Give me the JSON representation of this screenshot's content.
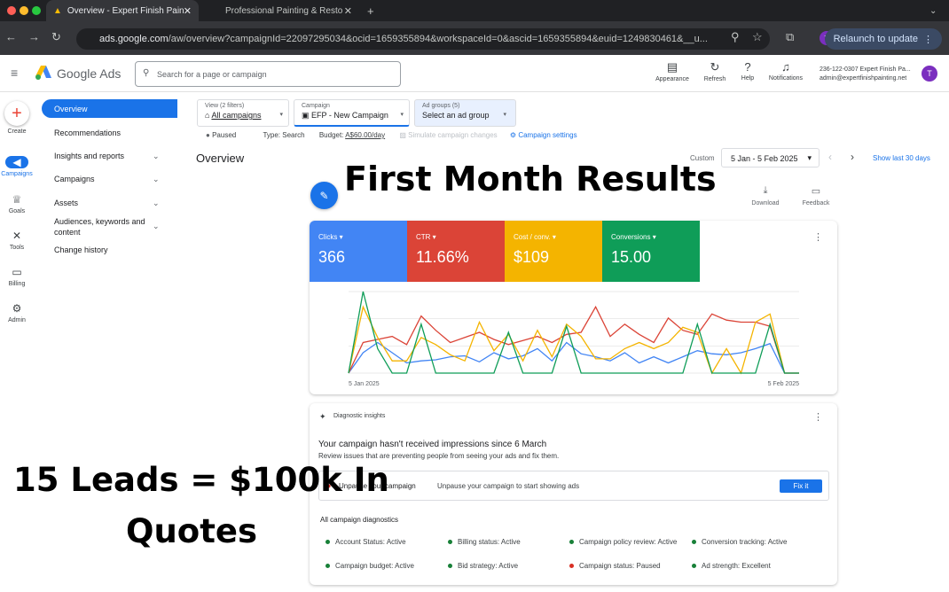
{
  "browser": {
    "tabs": [
      {
        "label": "Overview - Expert Finish Pain"
      },
      {
        "label": "Professional Painting & Resto"
      }
    ],
    "url_host": "ads.google.com",
    "url_path": "/aw/overview?campaignId=22097295034&ocid=1659355894&workspaceId=0&ascid=1659355894&euid=1249830461&__u...",
    "profile_initial": "T",
    "relaunch_label": "Relaunch to update"
  },
  "topbar": {
    "product_name": "Google Ads",
    "search_placeholder": "Search for a page or campaign",
    "icons": [
      {
        "label": "Appearance"
      },
      {
        "label": "Refresh"
      },
      {
        "label": "Help"
      },
      {
        "label": "Notifications"
      }
    ],
    "account_line1": "236-122-0307 Expert Finish Pa...",
    "account_line2": "admin@expertfinishpainting.net",
    "avatar_initial": "T"
  },
  "rail": {
    "create": "Create",
    "items": [
      {
        "label": "Campaigns"
      },
      {
        "label": "Goals"
      },
      {
        "label": "Tools"
      },
      {
        "label": "Billing"
      },
      {
        "label": "Admin"
      }
    ]
  },
  "menu": {
    "items": [
      {
        "label": "Overview"
      },
      {
        "label": "Recommendations"
      },
      {
        "label": "Insights and reports"
      },
      {
        "label": "Campaigns"
      },
      {
        "label": "Assets"
      },
      {
        "label": "Audiences, keywords and content"
      },
      {
        "label": "Change history"
      }
    ]
  },
  "filters": {
    "view_label": "View (2 filters)",
    "view_value": "All campaigns",
    "campaign_label": "Campaign",
    "campaign_value": "EFP - New Campaign",
    "adgroups_label": "Ad groups (5)",
    "adgroups_value": "Select an ad group"
  },
  "status": {
    "paused": "Paused",
    "type": "Type: Search",
    "budget_label": "Budget:",
    "budget_value": "A$60.00/day",
    "simulate": "Simulate campaign changes",
    "settings": "Campaign settings"
  },
  "header": {
    "page_title": "Overview",
    "date_custom": "Custom",
    "date_range": "5 Jan - 5 Feb 2025",
    "show_last": "Show last 30 days",
    "download": "Download",
    "feedback": "Feedback"
  },
  "metrics": [
    {
      "label": "Clicks",
      "value": "366",
      "color": "#4285f4"
    },
    {
      "label": "CTR",
      "value": "11.66%",
      "color": "#db4437"
    },
    {
      "label": "Cost / conv.",
      "value": "$109",
      "color": "#f4b400"
    },
    {
      "label": "Conversions",
      "value": "15.00",
      "color": "#0f9d58"
    }
  ],
  "chart_data": {
    "type": "line",
    "x_start_label": "5 Jan 2025",
    "x_end_label": "5 Feb 2025",
    "series": [
      {
        "name": "Clicks",
        "color": "#4285f4",
        "values": [
          0,
          20,
          30,
          20,
          10,
          12,
          13,
          16,
          17,
          11,
          20,
          14,
          17,
          24,
          12,
          30,
          19,
          16,
          12,
          20,
          10,
          16,
          10,
          16,
          22,
          19,
          18,
          20,
          24,
          29,
          0,
          0
        ]
      },
      {
        "name": "CTR",
        "color": "#db4437",
        "values": [
          0,
          30,
          33,
          36,
          28,
          56,
          42,
          30,
          35,
          40,
          33,
          28,
          32,
          36,
          30,
          38,
          40,
          65,
          36,
          48,
          38,
          30,
          54,
          42,
          38,
          58,
          52,
          50,
          50,
          46,
          0,
          0
        ]
      },
      {
        "name": "Cost / conv.",
        "color": "#f4b400",
        "values": [
          0,
          65,
          35,
          12,
          12,
          35,
          28,
          18,
          12,
          50,
          22,
          38,
          12,
          42,
          16,
          48,
          36,
          14,
          14,
          24,
          30,
          24,
          30,
          45,
          40,
          0,
          24,
          0,
          50,
          58,
          0,
          0
        ]
      },
      {
        "name": "Conversions",
        "color": "#0f9d58",
        "values": [
          0,
          80,
          24,
          0,
          0,
          48,
          0,
          0,
          0,
          0,
          0,
          40,
          0,
          0,
          0,
          46,
          0,
          0,
          0,
          0,
          0,
          0,
          0,
          0,
          48,
          0,
          0,
          0,
          0,
          48,
          0,
          0
        ]
      }
    ]
  },
  "diagnostics": {
    "title": "Diagnostic insights",
    "headline": "Your campaign hasn't received impressions since 6 March",
    "subtext": "Review issues that are preventing people from seeing your ads and fix them.",
    "action_title": "Unpause your campaign",
    "action_text": "Unpause your campaign to start showing ads",
    "fix_label": "Fix it",
    "all_title": "All campaign diagnostics",
    "items": [
      {
        "label": "Account Status: Active",
        "color": "#188038"
      },
      {
        "label": "Billing status: Active",
        "color": "#188038"
      },
      {
        "label": "Campaign policy review: Active",
        "color": "#188038"
      },
      {
        "label": "Conversion tracking: Active",
        "color": "#188038"
      },
      {
        "label": "Campaign budget: Active",
        "color": "#188038"
      },
      {
        "label": "Bid strategy: Active",
        "color": "#188038"
      },
      {
        "label": "Campaign status: Paused",
        "color": "#d93025"
      },
      {
        "label": "Ad strength: Excellent",
        "color": "#188038"
      }
    ]
  },
  "overlay": {
    "heading": "First Month Results",
    "leads_line1": "15 Leads = $100k In",
    "leads_line2": "Quotes"
  }
}
